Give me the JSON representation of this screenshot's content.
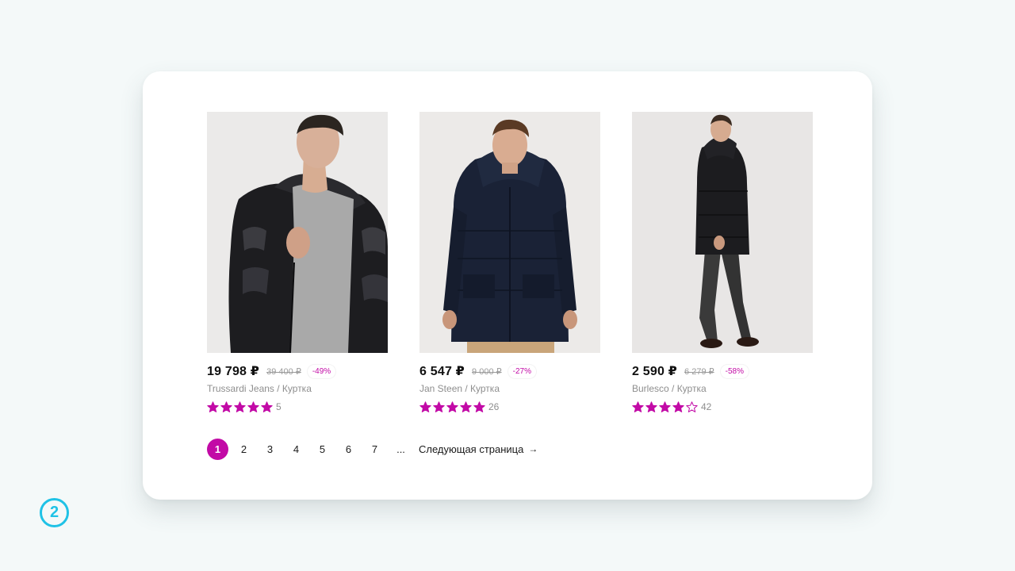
{
  "products": [
    {
      "price": "19 798 ₽",
      "old_price": "39 400 ₽",
      "discount": "-49%",
      "brand": "Trussardi Jeans / Куртка",
      "rating": 5,
      "reviews": "5",
      "image": "man-black-puffer-jacket-photo"
    },
    {
      "price": "6 547 ₽",
      "old_price": "9 000 ₽",
      "discount": "-27%",
      "brand": "Jan Steen / Куртка",
      "rating": 5,
      "reviews": "26",
      "image": "man-navy-parka-photo"
    },
    {
      "price": "2 590 ₽",
      "old_price": "6 279 ₽",
      "discount": "-58%",
      "brand": "Burlesco / Куртка",
      "rating": 4,
      "reviews": "42",
      "image": "man-black-coat-walking-photo"
    }
  ],
  "pagination": {
    "pages": [
      "1",
      "2",
      "3",
      "4",
      "5",
      "6",
      "7"
    ],
    "active": "1",
    "ellipsis": "...",
    "next_label": "Следующая страница",
    "next_icon": "arrow-right-icon"
  },
  "step_badge": "2",
  "colors": {
    "accent": "#c20aa6",
    "badge": "#1fc2e6",
    "background": "#f4f9f9"
  }
}
